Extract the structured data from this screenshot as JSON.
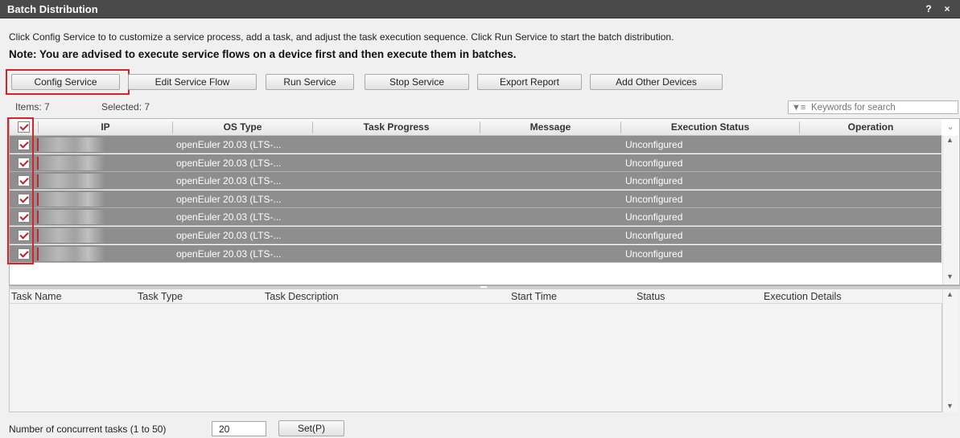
{
  "window": {
    "title": "Batch Distribution",
    "help_label": "?",
    "close_label": "×"
  },
  "description": "Click Config Service to to customize a service process, add a task, and adjust the task execution sequence. Click Run Service to start the batch distribution.",
  "note": "Note: You are advised to execute service flows on a device first and then execute them in batches.",
  "toolbar": {
    "config_service": "Config Service",
    "edit_service_flow": "Edit Service Flow",
    "run_service": "Run Service",
    "stop_service": "Stop Service",
    "export_report": "Export Report",
    "add_other_devices": "Add Other Devices"
  },
  "counts": {
    "items": "Items: 7",
    "selected": "Selected: 7"
  },
  "search": {
    "placeholder": "Keywords for search",
    "icon": "filter-icon"
  },
  "devices": {
    "columns": [
      "IP",
      "OS Type",
      "Task Progress",
      "Message",
      "Execution Status",
      "Operation"
    ],
    "rows": [
      {
        "checked": true,
        "ip": "",
        "os_type": "openEuler 20.03 (LTS-...",
        "task_progress": "",
        "message": "",
        "execution_status": "Unconfigured",
        "operation": ""
      },
      {
        "checked": true,
        "ip": "",
        "os_type": "openEuler 20.03 (LTS-...",
        "task_progress": "",
        "message": "",
        "execution_status": "Unconfigured",
        "operation": ""
      },
      {
        "checked": true,
        "ip": "",
        "os_type": "openEuler 20.03 (LTS-...",
        "task_progress": "",
        "message": "",
        "execution_status": "Unconfigured",
        "operation": ""
      },
      {
        "checked": true,
        "ip": "",
        "os_type": "openEuler 20.03 (LTS-...",
        "task_progress": "",
        "message": "",
        "execution_status": "Unconfigured",
        "operation": ""
      },
      {
        "checked": true,
        "ip": "",
        "os_type": "openEuler 20.03 (LTS-...",
        "task_progress": "",
        "message": "",
        "execution_status": "Unconfigured",
        "operation": ""
      },
      {
        "checked": true,
        "ip": "",
        "os_type": "openEuler 20.03 (LTS-...",
        "task_progress": "",
        "message": "",
        "execution_status": "Unconfigured",
        "operation": ""
      },
      {
        "checked": true,
        "ip": "",
        "os_type": "openEuler 20.03 (LTS-...",
        "task_progress": "",
        "message": "",
        "execution_status": "Unconfigured",
        "operation": ""
      }
    ]
  },
  "tasks": {
    "columns": [
      "Task Name",
      "Task Type",
      "Task Description",
      "Start Time",
      "Status",
      "Execution Details"
    ]
  },
  "footer": {
    "concurrent_label": "Number of concurrent tasks (1 to 50)",
    "concurrent_value": "20",
    "set_label": "Set(P)"
  },
  "colors": {
    "title_bar": "#4a4a4a",
    "selected_row": "#8e8e8e",
    "highlight": "#d9232b",
    "check": "#c4202a"
  }
}
